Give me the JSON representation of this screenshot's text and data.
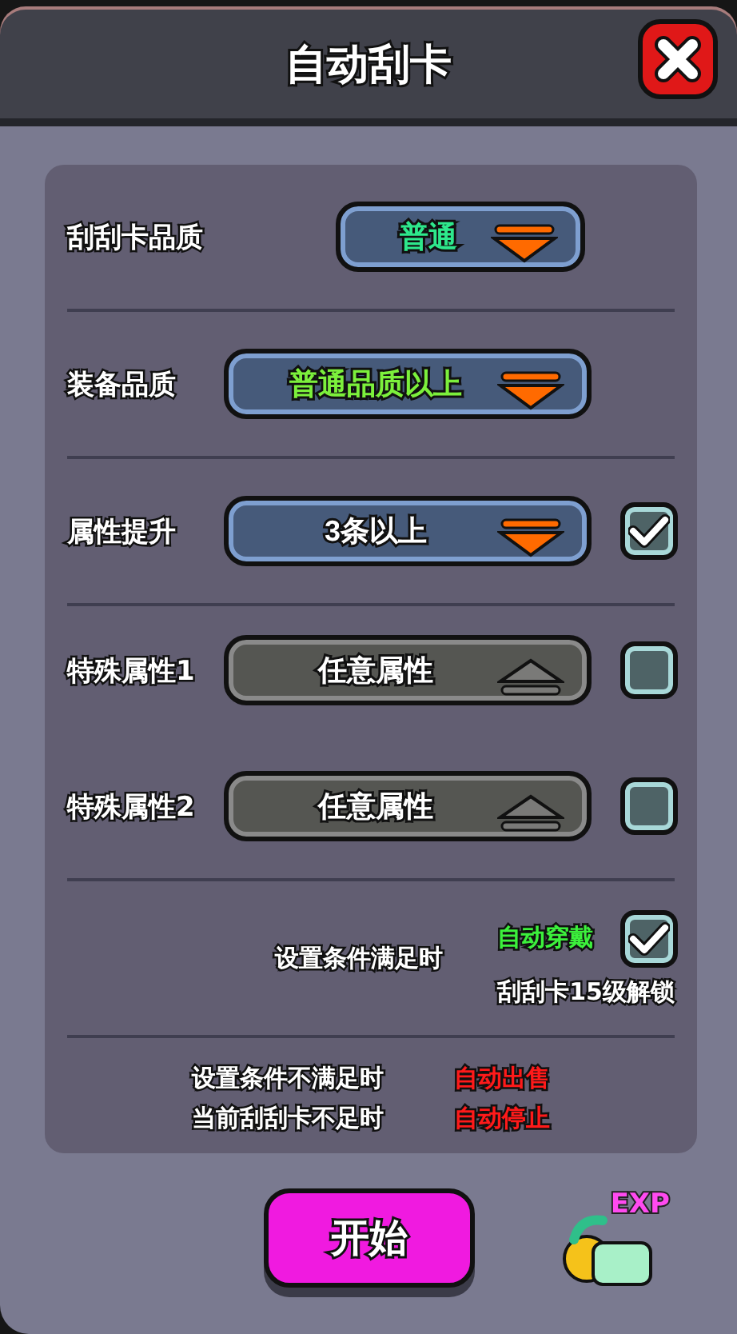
{
  "title": "自动刮卡",
  "rows": [
    {
      "label": "刮刮卡品质",
      "value": "普通",
      "kind": "compact",
      "disabled": false,
      "color": "#2ee88c"
    },
    {
      "label": "装备品质",
      "value": "普通品质以上",
      "kind": "full",
      "disabled": false,
      "color": "#7cf03c"
    },
    {
      "label": "属性提升",
      "value": "3条以上",
      "kind": "full",
      "disabled": false,
      "color": "#ffffff",
      "checked": true
    },
    {
      "label": "特殊属性1",
      "value": "任意属性",
      "kind": "full",
      "disabled": true,
      "color": "#ffffff",
      "checked": false
    },
    {
      "label": "特殊属性2",
      "value": "任意属性",
      "kind": "full",
      "disabled": true,
      "color": "#ffffff",
      "checked": false
    }
  ],
  "when_met": {
    "label": "设置条件满足时",
    "action": "自动穿戴",
    "checked": true,
    "note": "刮刮卡15级解锁"
  },
  "rules": [
    {
      "label": "设置条件不满足时",
      "action": "自动出售"
    },
    {
      "label": "当前刮刮卡不足时",
      "action": "自动停止"
    }
  ],
  "start_button": "开始",
  "exp_badge": "EXP"
}
